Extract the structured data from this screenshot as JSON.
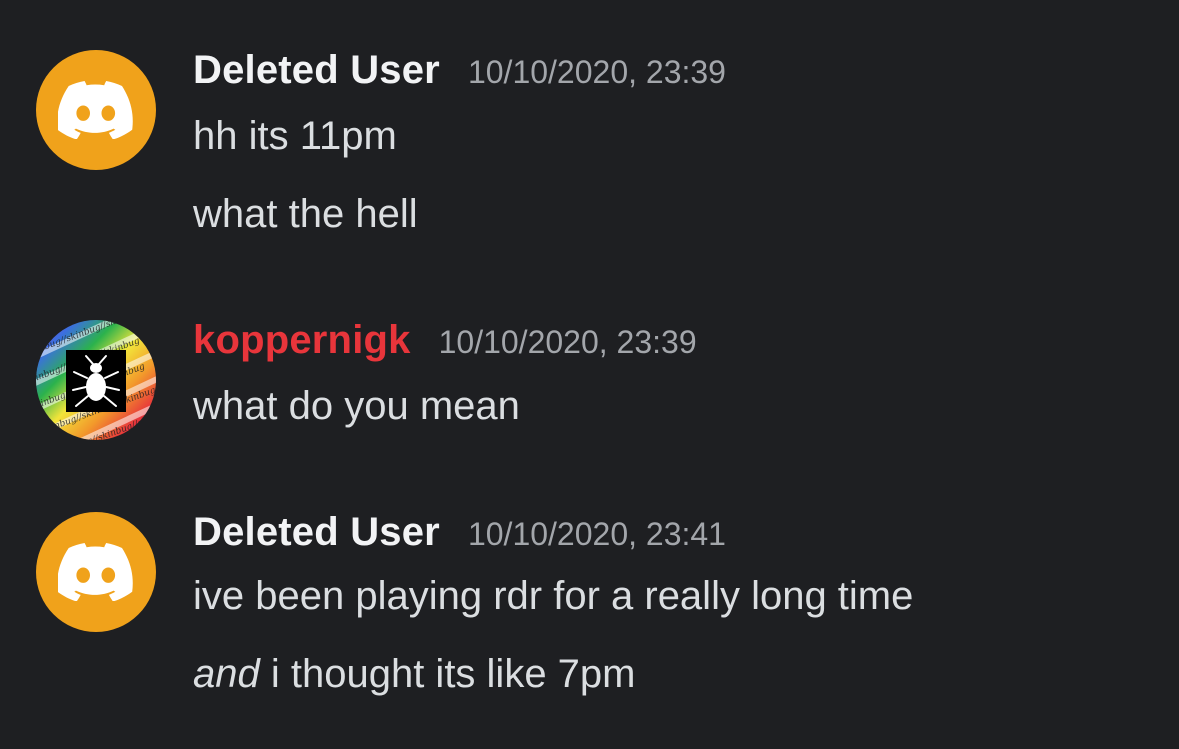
{
  "colors": {
    "background": "#1e1f22",
    "default_avatar": "#f0a21b",
    "username_default": "#f2f3f5",
    "username_kopper": "#e8353b",
    "timestamp": "#a3a6ab",
    "message_text": "#dbdee1"
  },
  "messages": [
    {
      "author": "Deleted User",
      "avatar_icon": "discord-logo-icon",
      "timestamp": "10/10/2020, 23:39",
      "lines": [
        "hh its 11pm",
        "what the hell"
      ]
    },
    {
      "author": "koppernigk",
      "avatar_icon": "bug-on-rainbow-avatar",
      "avatar_text": "skinbug//skinbug//skinbug",
      "timestamp": "10/10/2020, 23:39",
      "lines": [
        "what do you mean"
      ]
    },
    {
      "author": "Deleted User",
      "avatar_icon": "discord-logo-icon",
      "timestamp": "10/10/2020, 23:41",
      "lines": [
        "ive been playing rdr for a really long time"
      ],
      "emphasis_line": {
        "emphasized": "and",
        "rest": " i thought its like 7pm"
      }
    }
  ]
}
